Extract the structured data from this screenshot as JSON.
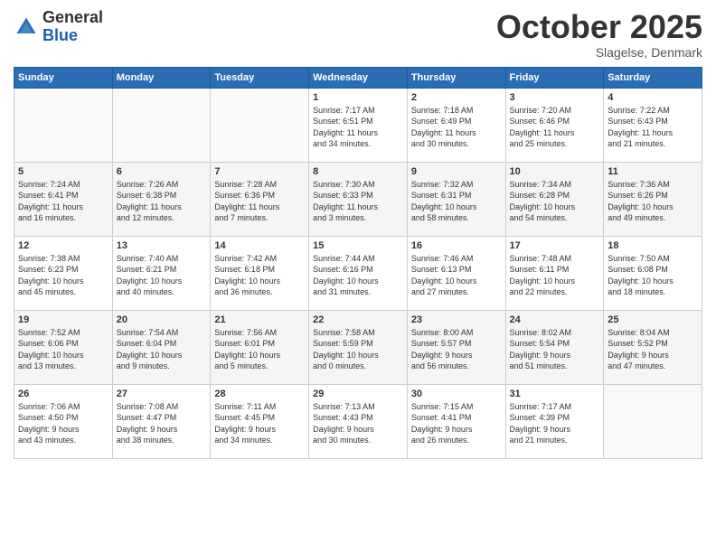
{
  "logo": {
    "general": "General",
    "blue": "Blue"
  },
  "header": {
    "month": "October 2025",
    "location": "Slagelse, Denmark"
  },
  "days_of_week": [
    "Sunday",
    "Monday",
    "Tuesday",
    "Wednesday",
    "Thursday",
    "Friday",
    "Saturday"
  ],
  "weeks": [
    [
      {
        "day": "",
        "info": ""
      },
      {
        "day": "",
        "info": ""
      },
      {
        "day": "",
        "info": ""
      },
      {
        "day": "1",
        "info": "Sunrise: 7:17 AM\nSunset: 6:51 PM\nDaylight: 11 hours\nand 34 minutes."
      },
      {
        "day": "2",
        "info": "Sunrise: 7:18 AM\nSunset: 6:49 PM\nDaylight: 11 hours\nand 30 minutes."
      },
      {
        "day": "3",
        "info": "Sunrise: 7:20 AM\nSunset: 6:46 PM\nDaylight: 11 hours\nand 25 minutes."
      },
      {
        "day": "4",
        "info": "Sunrise: 7:22 AM\nSunset: 6:43 PM\nDaylight: 11 hours\nand 21 minutes."
      }
    ],
    [
      {
        "day": "5",
        "info": "Sunrise: 7:24 AM\nSunset: 6:41 PM\nDaylight: 11 hours\nand 16 minutes."
      },
      {
        "day": "6",
        "info": "Sunrise: 7:26 AM\nSunset: 6:38 PM\nDaylight: 11 hours\nand 12 minutes."
      },
      {
        "day": "7",
        "info": "Sunrise: 7:28 AM\nSunset: 6:36 PM\nDaylight: 11 hours\nand 7 minutes."
      },
      {
        "day": "8",
        "info": "Sunrise: 7:30 AM\nSunset: 6:33 PM\nDaylight: 11 hours\nand 3 minutes."
      },
      {
        "day": "9",
        "info": "Sunrise: 7:32 AM\nSunset: 6:31 PM\nDaylight: 10 hours\nand 58 minutes."
      },
      {
        "day": "10",
        "info": "Sunrise: 7:34 AM\nSunset: 6:28 PM\nDaylight: 10 hours\nand 54 minutes."
      },
      {
        "day": "11",
        "info": "Sunrise: 7:36 AM\nSunset: 6:26 PM\nDaylight: 10 hours\nand 49 minutes."
      }
    ],
    [
      {
        "day": "12",
        "info": "Sunrise: 7:38 AM\nSunset: 6:23 PM\nDaylight: 10 hours\nand 45 minutes."
      },
      {
        "day": "13",
        "info": "Sunrise: 7:40 AM\nSunset: 6:21 PM\nDaylight: 10 hours\nand 40 minutes."
      },
      {
        "day": "14",
        "info": "Sunrise: 7:42 AM\nSunset: 6:18 PM\nDaylight: 10 hours\nand 36 minutes."
      },
      {
        "day": "15",
        "info": "Sunrise: 7:44 AM\nSunset: 6:16 PM\nDaylight: 10 hours\nand 31 minutes."
      },
      {
        "day": "16",
        "info": "Sunrise: 7:46 AM\nSunset: 6:13 PM\nDaylight: 10 hours\nand 27 minutes."
      },
      {
        "day": "17",
        "info": "Sunrise: 7:48 AM\nSunset: 6:11 PM\nDaylight: 10 hours\nand 22 minutes."
      },
      {
        "day": "18",
        "info": "Sunrise: 7:50 AM\nSunset: 6:08 PM\nDaylight: 10 hours\nand 18 minutes."
      }
    ],
    [
      {
        "day": "19",
        "info": "Sunrise: 7:52 AM\nSunset: 6:06 PM\nDaylight: 10 hours\nand 13 minutes."
      },
      {
        "day": "20",
        "info": "Sunrise: 7:54 AM\nSunset: 6:04 PM\nDaylight: 10 hours\nand 9 minutes."
      },
      {
        "day": "21",
        "info": "Sunrise: 7:56 AM\nSunset: 6:01 PM\nDaylight: 10 hours\nand 5 minutes."
      },
      {
        "day": "22",
        "info": "Sunrise: 7:58 AM\nSunset: 5:59 PM\nDaylight: 10 hours\nand 0 minutes."
      },
      {
        "day": "23",
        "info": "Sunrise: 8:00 AM\nSunset: 5:57 PM\nDaylight: 9 hours\nand 56 minutes."
      },
      {
        "day": "24",
        "info": "Sunrise: 8:02 AM\nSunset: 5:54 PM\nDaylight: 9 hours\nand 51 minutes."
      },
      {
        "day": "25",
        "info": "Sunrise: 8:04 AM\nSunset: 5:52 PM\nDaylight: 9 hours\nand 47 minutes."
      }
    ],
    [
      {
        "day": "26",
        "info": "Sunrise: 7:06 AM\nSunset: 4:50 PM\nDaylight: 9 hours\nand 43 minutes."
      },
      {
        "day": "27",
        "info": "Sunrise: 7:08 AM\nSunset: 4:47 PM\nDaylight: 9 hours\nand 38 minutes."
      },
      {
        "day": "28",
        "info": "Sunrise: 7:11 AM\nSunset: 4:45 PM\nDaylight: 9 hours\nand 34 minutes."
      },
      {
        "day": "29",
        "info": "Sunrise: 7:13 AM\nSunset: 4:43 PM\nDaylight: 9 hours\nand 30 minutes."
      },
      {
        "day": "30",
        "info": "Sunrise: 7:15 AM\nSunset: 4:41 PM\nDaylight: 9 hours\nand 26 minutes."
      },
      {
        "day": "31",
        "info": "Sunrise: 7:17 AM\nSunset: 4:39 PM\nDaylight: 9 hours\nand 21 minutes."
      },
      {
        "day": "",
        "info": ""
      }
    ]
  ]
}
